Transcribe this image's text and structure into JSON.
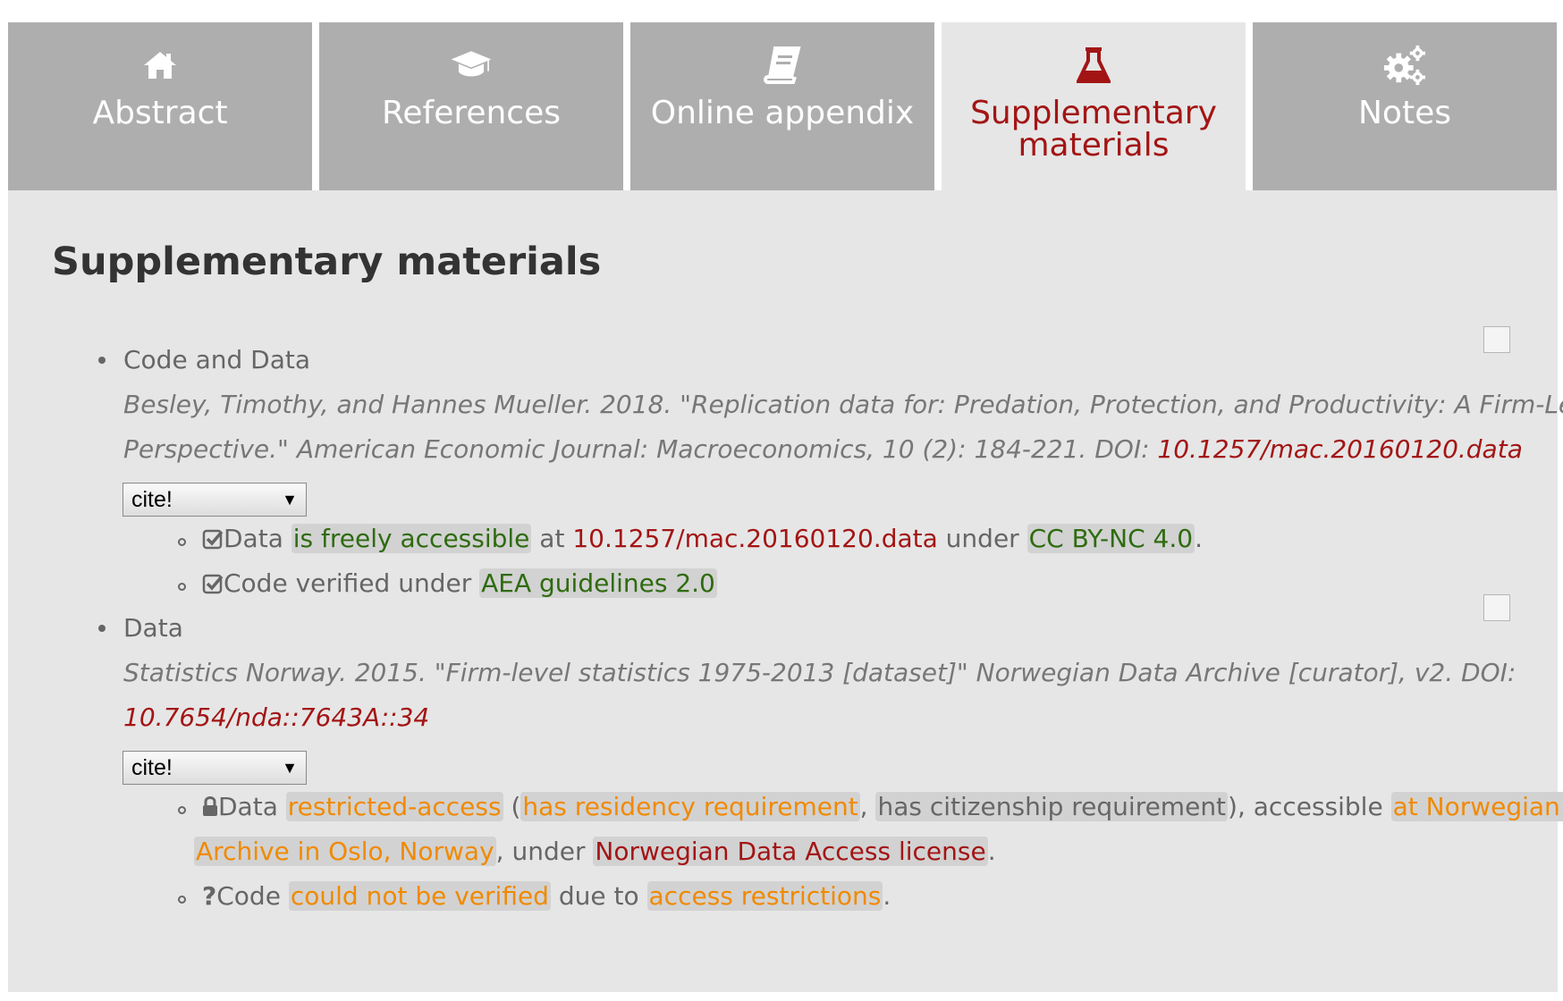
{
  "tabs": [
    {
      "label": "Abstract",
      "icon": "home-icon"
    },
    {
      "label": "References",
      "icon": "graduation-cap-icon"
    },
    {
      "label": "Online appendix",
      "icon": "book-icon"
    },
    {
      "label": "Supplementary materials",
      "icon": "flask-icon",
      "active": true
    },
    {
      "label": "Notes",
      "icon": "gears-icon"
    }
  ],
  "colors": {
    "tab_bg": "#aeaeae",
    "active_accent": "#a31515",
    "panel_bg": "#e6e6e6",
    "ok_green": "#2e6b0f",
    "warn_orange": "#f08a00"
  },
  "page_title": "Supplementary materials",
  "items": [
    {
      "type": "Code and Data",
      "citation_text_1": "Besley, Timothy, and Hannes Mueller. 2018. \"Replication data for: Predation, Protection, and Productivity: A Firm-Level",
      "citation_text_2": "Perspective.\" American Economic Journal: Macroeconomics, 10 (2): 184-221. DOI: ",
      "citation_doi": "10.1257/mac.20160120.data",
      "cite_select": "cite!",
      "subitems": {
        "data": {
          "icon": "checkbox-checked-icon",
          "prefix": "Data ",
          "access": "is freely accessible",
          "at": " at ",
          "location": "10.1257/mac.20160120.data",
          "under": " under ",
          "license": "CC BY-NC 4.0",
          "end": "."
        },
        "code": {
          "icon": "checkbox-checked-icon",
          "prefix": "Code verified under ",
          "guideline": "AEA guidelines 2.0"
        }
      }
    },
    {
      "type": "Data",
      "citation_text_1": "Statistics Norway. 2015. \"Firm-level statistics 1975-2013 [dataset]\" Norwegian Data Archive [curator], v2. DOI:",
      "citation_doi": "10.7654/nda::7643A::34",
      "cite_select": "cite!",
      "subitems": {
        "data": {
          "icon": "lock-icon",
          "prefix": "Data ",
          "access": "restricted-access",
          "open_paren": " (",
          "req1": "has residency requirement",
          "comma": ", ",
          "req2": "has citizenship requirement",
          "accessible": "), accessible ",
          "location_1": "at Norwegian Data",
          "location_2": "Archive in Oslo, Norway",
          "under": ", under ",
          "license": "Norwegian Data Access license",
          "end": "."
        },
        "code": {
          "icon": "question-icon",
          "prefix": "Code ",
          "status": "could not be verified",
          "due": " due to ",
          "reason": "access restrictions",
          "end": "."
        }
      }
    }
  ]
}
